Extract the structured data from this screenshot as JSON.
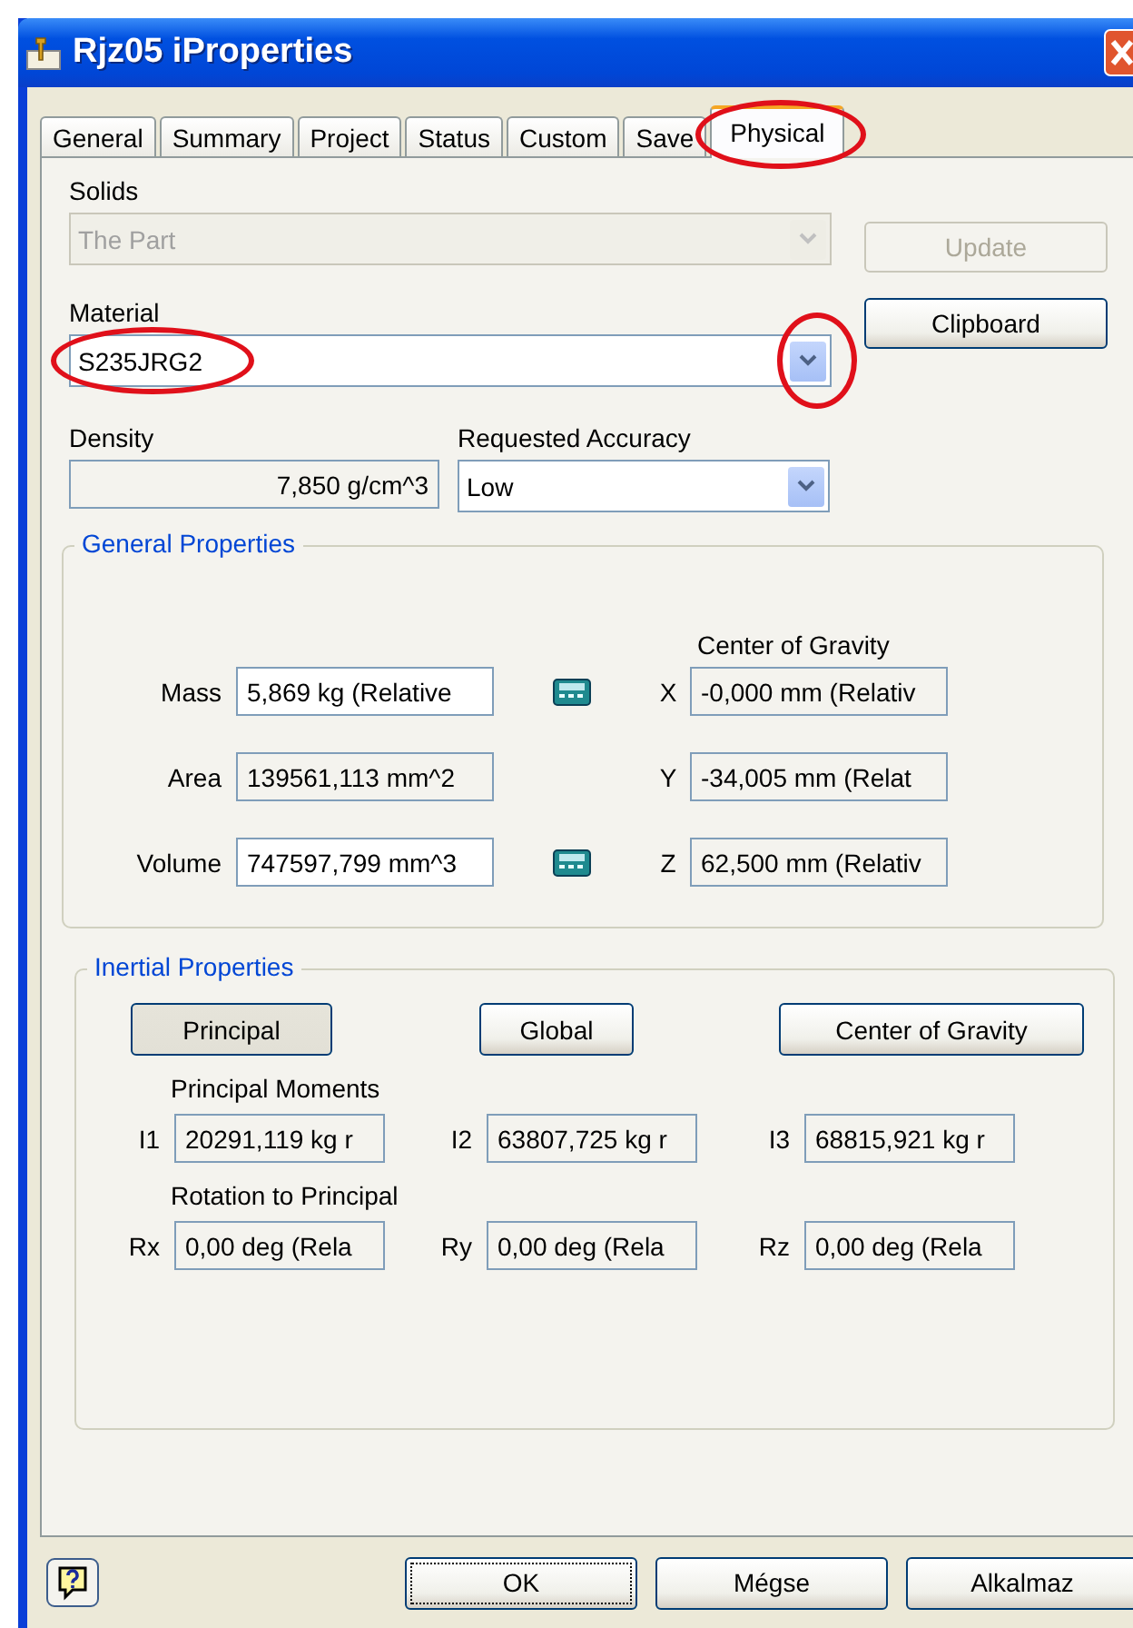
{
  "window": {
    "title": "Rjz05 iProperties"
  },
  "tabs": [
    {
      "label": "General",
      "selected": false,
      "circled": false
    },
    {
      "label": "Summary",
      "selected": false,
      "circled": false
    },
    {
      "label": "Project",
      "selected": false,
      "circled": false
    },
    {
      "label": "Status",
      "selected": false,
      "circled": false
    },
    {
      "label": "Custom",
      "selected": false,
      "circled": false
    },
    {
      "label": "Save",
      "selected": false,
      "circled": false
    },
    {
      "label": "Physical",
      "selected": true,
      "circled": true
    }
  ],
  "solids": {
    "label": "Solids",
    "value": "The Part",
    "disabled": true
  },
  "update_button": {
    "label": "Update",
    "disabled": true
  },
  "material": {
    "label": "Material",
    "value": "S235JRG2",
    "value_circled": true,
    "arrow_circled": true
  },
  "clipboard_button": {
    "label": "Clipboard"
  },
  "density": {
    "label": "Density",
    "value": "7,850 g/cm^3"
  },
  "accuracy": {
    "label": "Requested Accuracy",
    "value": "Low"
  },
  "general": {
    "title": "General Properties",
    "cog_heading": "Center of Gravity",
    "rows": [
      {
        "label": "Mass",
        "value": "5,869 kg (Relative",
        "editable": true,
        "calculator": true,
        "axis": "X",
        "cog": "-0,000 mm (Relativ"
      },
      {
        "label": "Area",
        "value": "139561,113 mm^2",
        "editable": false,
        "calculator": false,
        "axis": "Y",
        "cog": "-34,005 mm (Relat"
      },
      {
        "label": "Volume",
        "value": "747597,799 mm^3",
        "editable": true,
        "calculator": true,
        "axis": "Z",
        "cog": "62,500 mm (Relativ"
      }
    ]
  },
  "inertial": {
    "title": "Inertial Properties",
    "buttons": [
      {
        "label": "Principal",
        "selected": true
      },
      {
        "label": "Global",
        "selected": false
      },
      {
        "label": "Center of Gravity",
        "selected": false
      }
    ],
    "moments_heading": "Principal Moments",
    "moments": [
      {
        "label": "I1",
        "value": "20291,119 kg r"
      },
      {
        "label": "I2",
        "value": "63807,725 kg r"
      },
      {
        "label": "I3",
        "value": "68815,921 kg r"
      }
    ],
    "rotation_heading": "Rotation to Principal",
    "rotations": [
      {
        "label": "Rx",
        "value": "0,00 deg (Rela"
      },
      {
        "label": "Ry",
        "value": "0,00 deg (Rela"
      },
      {
        "label": "Rz",
        "value": "0,00 deg (Rela"
      }
    ]
  },
  "footer": {
    "buttons": [
      {
        "label": "OK",
        "focused": true
      },
      {
        "label": "Mégse",
        "focused": false
      },
      {
        "label": "Alkalmaz",
        "focused": false
      }
    ]
  }
}
